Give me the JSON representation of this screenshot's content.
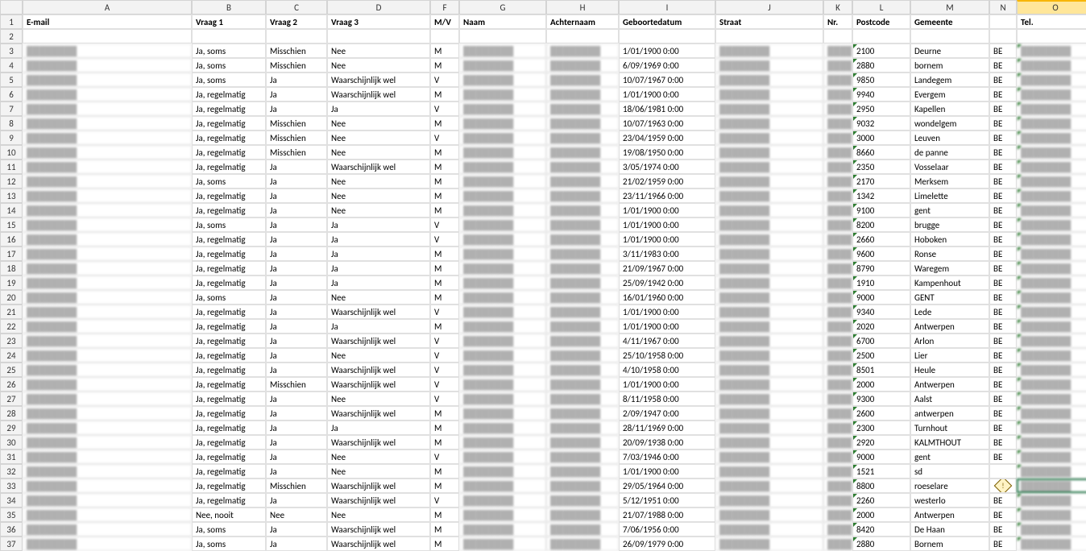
{
  "columns": [
    "A",
    "B",
    "C",
    "D",
    "F",
    "G",
    "H",
    "I",
    "J",
    "K",
    "L",
    "M",
    "N",
    "O"
  ],
  "headers": {
    "A": "E-mail",
    "B": "Vraag 1",
    "C": "Vraag 2",
    "D": "Vraag 3",
    "F": "M/V",
    "G": "Naam",
    "H": "Achternaam",
    "I": "Geboortedatum",
    "J": "Straat",
    "K": "Nr.",
    "L": "Postcode",
    "M": "Gemeente",
    "N": "",
    "O": "Tel."
  },
  "active_cell": "O33",
  "selected_column": "O",
  "rows": [
    {
      "n": 3,
      "B": "Ja, soms",
      "C": "Misschien",
      "D": "Nee",
      "F": "M",
      "I": "1/01/1900 0:00",
      "L": "2100",
      "M": "Deurne",
      "N": "BE"
    },
    {
      "n": 4,
      "B": "Ja, soms",
      "C": "Misschien",
      "D": "Nee",
      "F": "M",
      "I": "6/09/1969 0:00",
      "L": "2880",
      "M": "bornem",
      "N": "BE"
    },
    {
      "n": 5,
      "B": "Ja, soms",
      "C": "Ja",
      "D": "Waarschijnlijk wel",
      "F": "V",
      "I": "10/07/1967 0:00",
      "L": "9850",
      "M": "Landegem",
      "N": "BE"
    },
    {
      "n": 6,
      "B": "Ja, regelmatig",
      "C": "Ja",
      "D": "Waarschijnlijk wel",
      "F": "M",
      "I": "1/01/1900 0:00",
      "L": "9940",
      "M": "Evergem",
      "N": "BE"
    },
    {
      "n": 7,
      "B": "Ja, regelmatig",
      "C": "Ja",
      "D": "Ja",
      "F": "V",
      "I": "18/06/1981 0:00",
      "L": "2950",
      "M": "Kapellen",
      "N": "BE"
    },
    {
      "n": 8,
      "B": "Ja, regelmatig",
      "C": "Misschien",
      "D": "Nee",
      "F": "M",
      "I": "10/07/1963 0:00",
      "L": "9032",
      "M": "wondelgem",
      "N": "BE"
    },
    {
      "n": 9,
      "B": "Ja, regelmatig",
      "C": "Misschien",
      "D": "Nee",
      "F": "V",
      "I": "23/04/1959 0:00",
      "L": "3000",
      "M": "Leuven",
      "N": "BE"
    },
    {
      "n": 10,
      "B": "Ja, regelmatig",
      "C": "Misschien",
      "D": "Nee",
      "F": "M",
      "I": "19/08/1950 0:00",
      "L": "8660",
      "M": "de panne",
      "N": "BE"
    },
    {
      "n": 11,
      "B": "Ja, regelmatig",
      "C": "Ja",
      "D": "Waarschijnlijk wel",
      "F": "M",
      "I": "3/05/1974 0:00",
      "L": "2350",
      "M": "Vosselaar",
      "N": "BE"
    },
    {
      "n": 12,
      "B": "Ja, soms",
      "C": "Ja",
      "D": "Nee",
      "F": "M",
      "I": "21/02/1959 0:00",
      "L": "2170",
      "M": "Merksem",
      "N": "BE"
    },
    {
      "n": 13,
      "B": "Ja, regelmatig",
      "C": "Ja",
      "D": "Nee",
      "F": "M",
      "I": "23/11/1966 0:00",
      "L": "1342",
      "M": "Limelette",
      "N": "BE"
    },
    {
      "n": 14,
      "B": "Ja, regelmatig",
      "C": "Ja",
      "D": "Nee",
      "F": "M",
      "I": "1/01/1900 0:00",
      "L": "9100",
      "M": "gent",
      "N": "BE"
    },
    {
      "n": 15,
      "B": "Ja, soms",
      "C": "Ja",
      "D": "Ja",
      "F": "V",
      "I": "1/01/1900 0:00",
      "L": "8200",
      "M": "brugge",
      "N": "BE"
    },
    {
      "n": 16,
      "B": "Ja, regelmatig",
      "C": "Ja",
      "D": "Ja",
      "F": "V",
      "I": "1/01/1900 0:00",
      "L": "2660",
      "M": "Hoboken",
      "N": "BE"
    },
    {
      "n": 17,
      "B": "Ja, regelmatig",
      "C": "Ja",
      "D": "Ja",
      "F": "M",
      "I": "3/11/1983 0:00",
      "L": "9600",
      "M": "Ronse",
      "N": "BE"
    },
    {
      "n": 18,
      "B": "Ja, regelmatig",
      "C": "Ja",
      "D": "Ja",
      "F": "M",
      "I": "21/09/1967 0:00",
      "L": "8790",
      "M": "Waregem",
      "N": "BE"
    },
    {
      "n": 19,
      "B": "Ja, regelmatig",
      "C": "Ja",
      "D": "Ja",
      "F": "M",
      "I": "25/09/1942 0:00",
      "L": "1910",
      "M": "Kampenhout",
      "N": "BE"
    },
    {
      "n": 20,
      "B": "Ja, soms",
      "C": "Ja",
      "D": "Nee",
      "F": "M",
      "I": "16/01/1960 0:00",
      "L": "9000",
      "M": "GENT",
      "N": "BE"
    },
    {
      "n": 21,
      "B": "Ja, regelmatig",
      "C": "Ja",
      "D": "Waarschijnlijk wel",
      "F": "V",
      "I": "1/01/1900 0:00",
      "L": "9340",
      "M": "Lede",
      "N": "BE"
    },
    {
      "n": 22,
      "B": "Ja, regelmatig",
      "C": "Ja",
      "D": "Ja",
      "F": "M",
      "I": "1/01/1900 0:00",
      "L": "2020",
      "M": "Antwerpen",
      "N": "BE"
    },
    {
      "n": 23,
      "B": "Ja, regelmatig",
      "C": "Ja",
      "D": "Waarschijnlijk wel",
      "F": "V",
      "I": "4/11/1967 0:00",
      "L": "6700",
      "M": "Arlon",
      "N": "BE"
    },
    {
      "n": 24,
      "B": "Ja, regelmatig",
      "C": "Ja",
      "D": "Nee",
      "F": "V",
      "I": "25/10/1958 0:00",
      "L": "2500",
      "M": "Lier",
      "N": "BE"
    },
    {
      "n": 25,
      "B": "Ja, regelmatig",
      "C": "Ja",
      "D": "Waarschijnlijk wel",
      "F": "V",
      "I": "4/10/1958 0:00",
      "L": "8501",
      "M": "Heule",
      "N": "BE"
    },
    {
      "n": 26,
      "B": "Ja, regelmatig",
      "C": "Misschien",
      "D": "Waarschijnlijk wel",
      "F": "V",
      "I": "1/01/1900 0:00",
      "L": "2000",
      "M": "Antwerpen",
      "N": "BE"
    },
    {
      "n": 27,
      "B": "Ja, regelmatig",
      "C": "Ja",
      "D": "Nee",
      "F": "V",
      "I": "8/11/1958 0:00",
      "L": "9300",
      "M": "Aalst",
      "N": "BE"
    },
    {
      "n": 28,
      "B": "Ja, regelmatig",
      "C": "Ja",
      "D": "Waarschijnlijk wel",
      "F": "M",
      "I": "2/09/1947 0:00",
      "L": "2600",
      "M": "antwerpen",
      "N": "BE"
    },
    {
      "n": 29,
      "B": "Ja, regelmatig",
      "C": "Ja",
      "D": "Ja",
      "F": "M",
      "I": "28/11/1969 0:00",
      "L": "2300",
      "M": "Turnhout",
      "N": "BE"
    },
    {
      "n": 30,
      "B": "Ja, regelmatig",
      "C": "Ja",
      "D": "Waarschijnlijk wel",
      "F": "M",
      "I": "20/09/1938 0:00",
      "L": "2920",
      "M": "KALMTHOUT",
      "N": "BE"
    },
    {
      "n": 31,
      "B": "Ja, regelmatig",
      "C": "Ja",
      "D": "Nee",
      "F": "V",
      "I": "7/03/1946 0:00",
      "L": "9000",
      "M": "gent",
      "N": "BE"
    },
    {
      "n": 32,
      "B": "Ja, regelmatig",
      "C": "Ja",
      "D": "Nee",
      "F": "M",
      "I": "1/01/1900 0:00",
      "L": "1521",
      "M": "sd",
      "N": ""
    },
    {
      "n": 33,
      "B": "Ja, regelmatig",
      "C": "Misschien",
      "D": "Waarschijnlijk wel",
      "F": "M",
      "I": "29/05/1964 0:00",
      "L": "8800",
      "M": "roeselare",
      "N": "◈"
    },
    {
      "n": 34,
      "B": "Ja, regelmatig",
      "C": "Ja",
      "D": "Waarschijnlijk wel",
      "F": "V",
      "I": "5/12/1951 0:00",
      "L": "2260",
      "M": "westerlo",
      "N": "BE"
    },
    {
      "n": 35,
      "B": "Nee, nooit",
      "C": "Nee",
      "D": "Nee",
      "F": "M",
      "I": "21/07/1988 0:00",
      "L": "2000",
      "M": "Antwerpen",
      "N": "BE"
    },
    {
      "n": 36,
      "B": "Ja, soms",
      "C": "Ja",
      "D": "Waarschijnlijk wel",
      "F": "M",
      "I": "7/06/1956 0:00",
      "L": "8420",
      "M": "De Haan",
      "N": "BE"
    },
    {
      "n": 37,
      "B": "Ja, soms",
      "C": "Ja",
      "D": "Waarschijnlijk wel",
      "F": "M",
      "I": "26/09/1979 0:00",
      "L": "2880",
      "M": "Bornem",
      "N": "BE"
    }
  ],
  "blur_placeholder": "████████"
}
